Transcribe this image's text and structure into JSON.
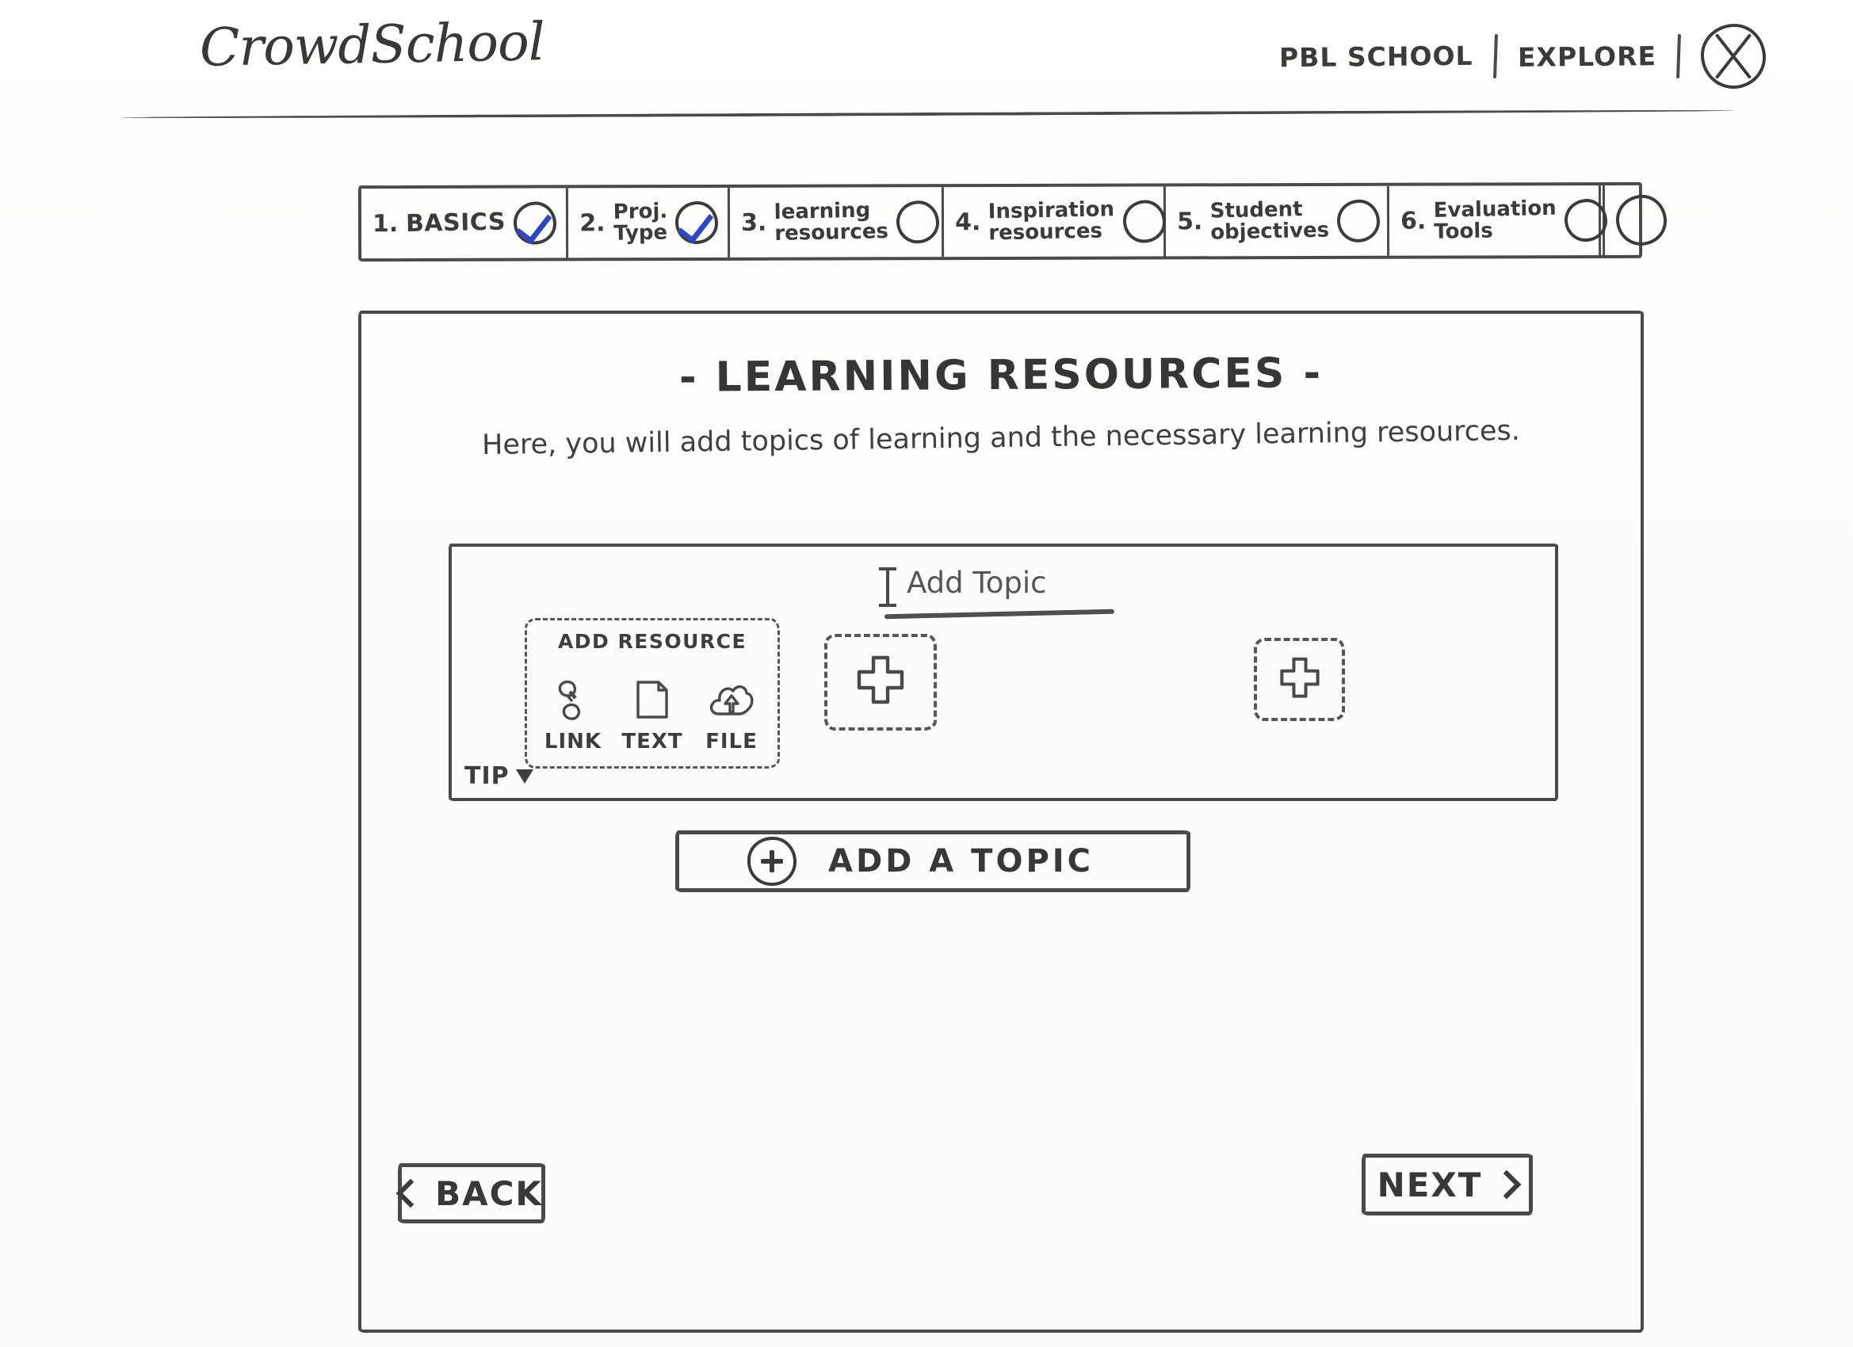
{
  "header": {
    "logo": "CrowdSchool",
    "nav": [
      {
        "label": "PBL SCHOOL"
      },
      {
        "label": "EXPLORE"
      }
    ],
    "avatar_icon": "circle-x-icon"
  },
  "steps": [
    {
      "num": "1.",
      "label": "BASICS",
      "state": "checked",
      "caps": true
    },
    {
      "num": "2.",
      "label": "Proj.\nType",
      "state": "checked",
      "caps": false
    },
    {
      "num": "3.",
      "label": "learning\nresources",
      "state": "empty",
      "caps": false
    },
    {
      "num": "4.",
      "label": "Inspiration\nresources",
      "state": "empty",
      "caps": false
    },
    {
      "num": "5.",
      "label": "Student\nobjectives",
      "state": "empty",
      "caps": false
    },
    {
      "num": "6.",
      "label": "Evaluation\nTools",
      "state": "empty",
      "caps": false
    },
    {
      "num": "",
      "label": "",
      "state": "empty",
      "caps": false
    }
  ],
  "panel": {
    "title": "- LEARNING RESOURCES -",
    "subtitle": "Here, you will add topics of learning and the necessary learning resources."
  },
  "topic_card": {
    "add_topic_input": {
      "value": "Add Topic",
      "placeholder": "Add Topic"
    },
    "add_resource": {
      "title": "ADD RESOURCE",
      "options": [
        {
          "label": "LINK",
          "icon": "link-chain-icon"
        },
        {
          "label": "TEXT",
          "icon": "document-icon"
        },
        {
          "label": "FILE",
          "icon": "cloud-upload-icon"
        }
      ]
    },
    "plus_slots": [
      {
        "icon": "plus-icon"
      },
      {
        "icon": "plus-icon"
      }
    ],
    "tip": {
      "label": "TIP",
      "caret_icon": "chevron-down-icon"
    }
  },
  "add_topic_button": {
    "label": "ADD A TOPIC",
    "icon": "circle-plus-icon"
  },
  "footer": {
    "back": {
      "label": "BACK",
      "icon": "chevron-left-icon"
    },
    "next": {
      "label": "NEXT",
      "icon": "chevron-right-icon"
    }
  },
  "colors": {
    "ink": "#3b3b3b",
    "check_blue": "#2e46c8",
    "paper": "#fdfdfc"
  }
}
